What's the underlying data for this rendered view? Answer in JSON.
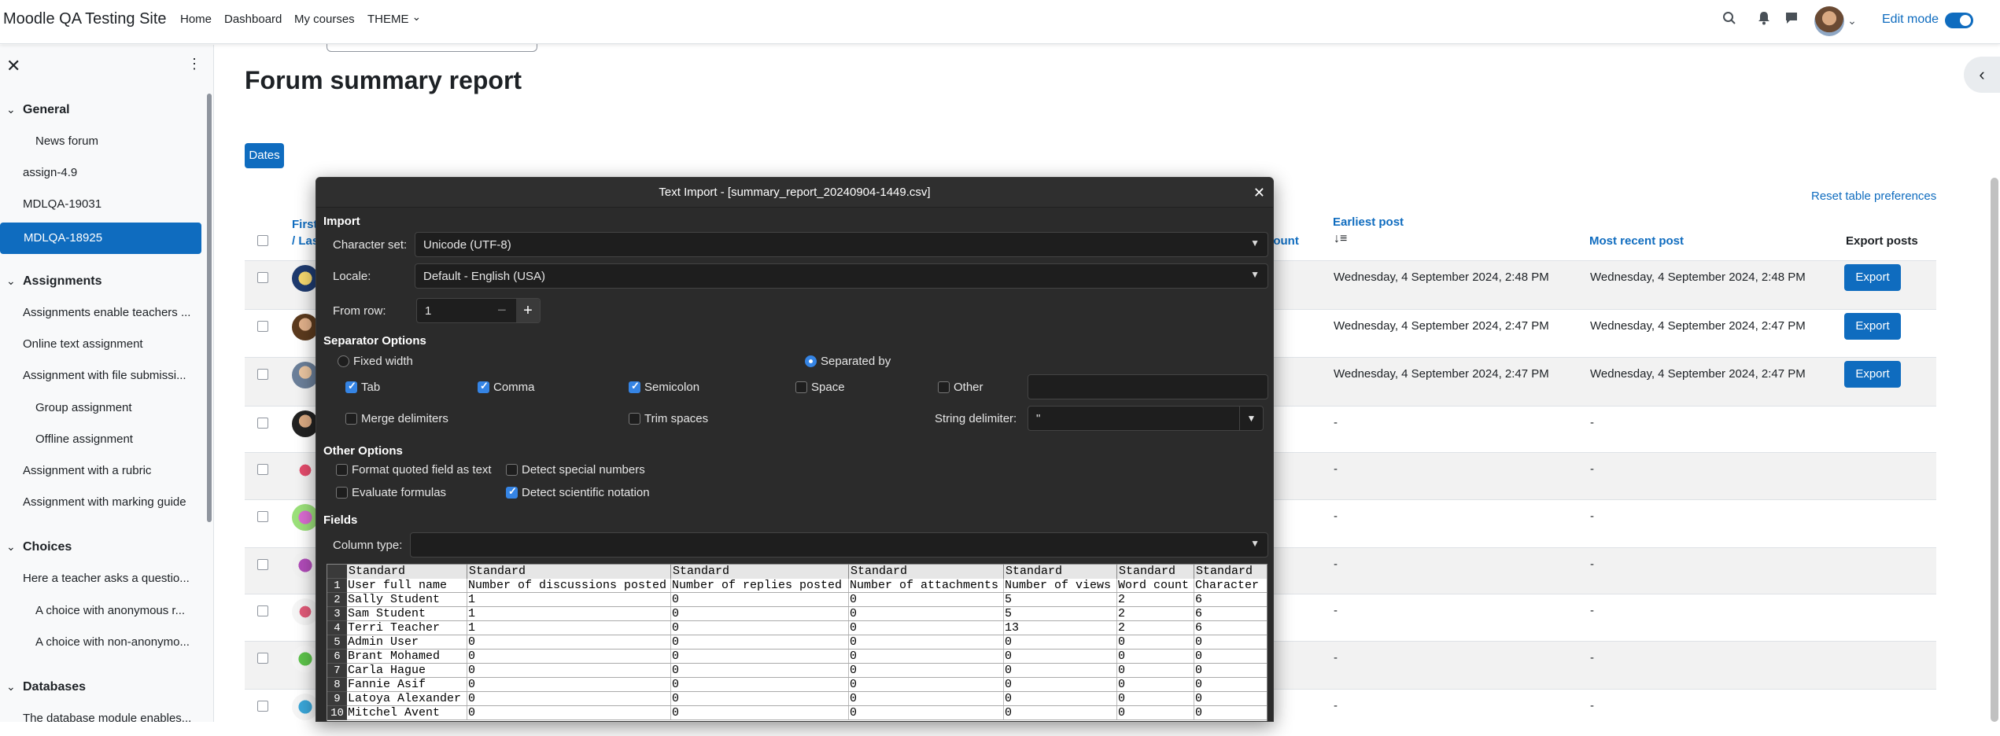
{
  "topnav": {
    "site_name": "Moodle QA Testing Site",
    "links": [
      "Home",
      "Dashboard",
      "My courses",
      "THEME"
    ],
    "edit_mode": "Edit mode"
  },
  "sidebar": {
    "sections": [
      {
        "title": "General",
        "items": [
          "News forum",
          "assign-4.9",
          "MDLQA-19031",
          "MDLQA-18925"
        ]
      },
      {
        "title": "Assignments",
        "items": [
          "Assignments enable teachers ...",
          "Online text assignment",
          "Assignment with file submissi...",
          "Group assignment",
          "Offline assignment",
          "Assignment with a rubric",
          "Assignment with marking guide"
        ]
      },
      {
        "title": "Choices",
        "items": [
          "Here a teacher asks a questio...",
          "A choice with anonymous r...",
          "A choice with non-anonymo..."
        ]
      },
      {
        "title": "Databases",
        "items": [
          "The database module enables..."
        ]
      }
    ]
  },
  "main": {
    "page_title": "Forum summary report",
    "dates_button": "Dates",
    "reset_link": "Reset table preferences",
    "col_first": "First",
    "col_last": "/ Las",
    "col_count_partial": "count",
    "col_earliest": "Earliest post",
    "col_recent": "Most recent post",
    "col_export": "Export posts",
    "export_label": "Export",
    "rows": [
      {
        "earliest": "Wednesday, 4 September 2024, 2:48 PM",
        "recent": "Wednesday, 4 September 2024, 2:48 PM",
        "export": true
      },
      {
        "earliest": "Wednesday, 4 September 2024, 2:47 PM",
        "recent": "Wednesday, 4 September 2024, 2:47 PM",
        "export": true
      },
      {
        "earliest": "Wednesday, 4 September 2024, 2:47 PM",
        "recent": "Wednesday, 4 September 2024, 2:47 PM",
        "export": true
      },
      {
        "earliest": "-",
        "recent": "-",
        "export": false
      },
      {
        "earliest": "-",
        "recent": "-",
        "export": false
      },
      {
        "earliest": "-",
        "recent": "-",
        "export": false
      },
      {
        "earliest": "-",
        "recent": "-",
        "export": false
      },
      {
        "earliest": "-",
        "recent": "-",
        "export": false
      },
      {
        "earliest": "-",
        "recent": "-",
        "export": false
      },
      {
        "earliest": "-",
        "recent": "-",
        "export": false
      }
    ]
  },
  "dialog": {
    "title": "Text Import - [summary_report_20240904-1449.csv]",
    "import_heading": "Import",
    "charset_label": "Character set:",
    "charset_value": "Unicode (UTF-8)",
    "locale_label": "Locale:",
    "locale_value": "Default - English (USA)",
    "fromrow_label": "From row:",
    "fromrow_value": "1",
    "separator_heading": "Separator Options",
    "fixed_width": "Fixed width",
    "separated_by": "Separated by",
    "tab": "Tab",
    "comma": "Comma",
    "semicolon": "Semicolon",
    "space": "Space",
    "other": "Other",
    "merge": "Merge delimiters",
    "trim": "Trim spaces",
    "string_delim_label": "String delimiter:",
    "string_delim_value": "\"",
    "other_heading": "Other Options",
    "format_quoted": "Format quoted field as text",
    "detect_special": "Detect special numbers",
    "evaluate": "Evaluate formulas",
    "detect_sci": "Detect scientific notation",
    "fields_heading": "Fields",
    "column_type_label": "Column type:",
    "preview": {
      "col_type": "Standard",
      "headers": [
        "User full name",
        "Number of discussions posted",
        "Number of replies posted",
        "Number of attachments",
        "Number of views",
        "Word count",
        "Character"
      ],
      "rows": [
        [
          "Sally Student",
          "1",
          "0",
          "0",
          "5",
          "2",
          "6"
        ],
        [
          "Sam Student",
          "1",
          "0",
          "0",
          "5",
          "2",
          "6"
        ],
        [
          "Terri Teacher",
          "1",
          "0",
          "0",
          "13",
          "2",
          "6"
        ],
        [
          "Admin User",
          "0",
          "0",
          "0",
          "0",
          "0",
          "0"
        ],
        [
          "Brant Mohamed",
          "0",
          "0",
          "0",
          "0",
          "0",
          "0"
        ],
        [
          "Carla Hague",
          "0",
          "0",
          "0",
          "0",
          "0",
          "0"
        ],
        [
          "Fannie Asif",
          "0",
          "0",
          "0",
          "0",
          "0",
          "0"
        ],
        [
          "Latoya Alexander",
          "0",
          "0",
          "0",
          "0",
          "0",
          "0"
        ],
        [
          "Mitchel Avent",
          "0",
          "0",
          "0",
          "0",
          "0",
          "0"
        ]
      ]
    }
  }
}
